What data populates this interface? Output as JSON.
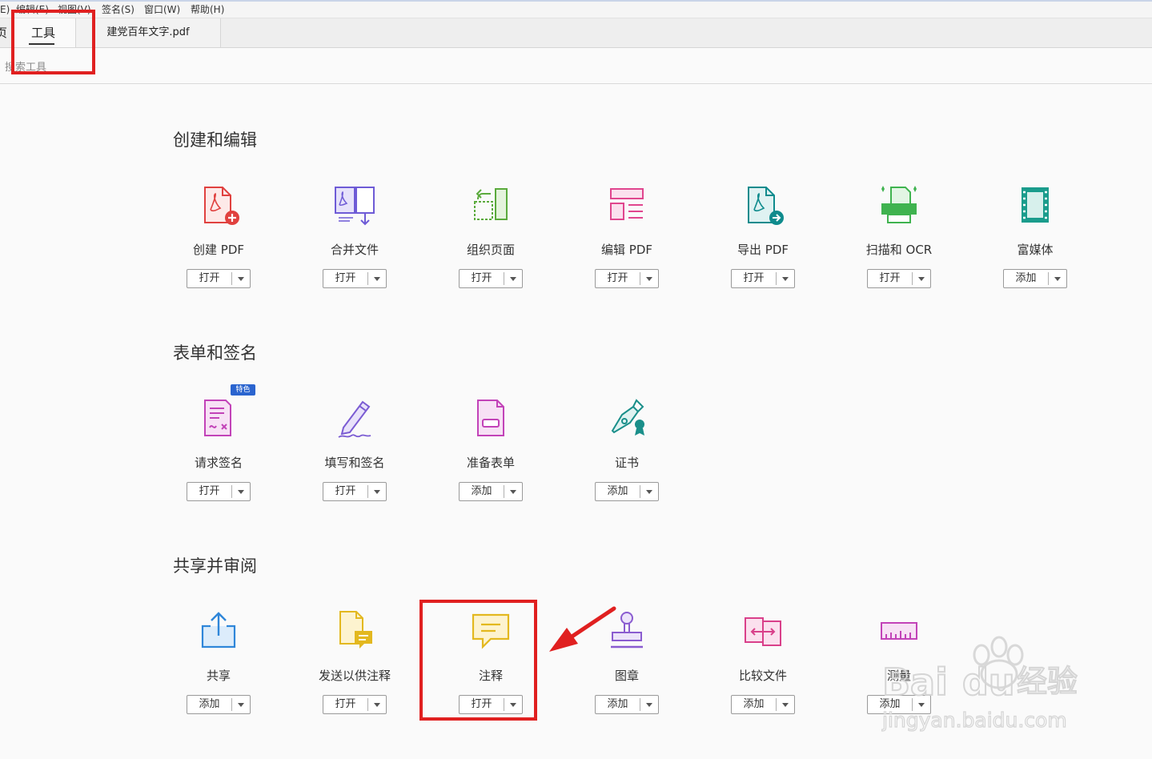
{
  "menubar": {
    "items": [
      {
        "label": "E)"
      },
      {
        "label": "编辑(E)"
      },
      {
        "label": "视图(V)"
      },
      {
        "label": "签名(S)"
      },
      {
        "label": "窗口(W)"
      },
      {
        "label": "帮助(H)"
      }
    ]
  },
  "tabs": {
    "home": "页",
    "tools": "工具",
    "document": "建党百年文字.pdf"
  },
  "search": {
    "label": "搜索工具"
  },
  "sections": [
    {
      "title": "创建和编辑",
      "tools": [
        {
          "label": "创建 PDF",
          "button": "打开",
          "icon": "create-pdf-icon",
          "color": "#e0413f"
        },
        {
          "label": "合并文件",
          "button": "打开",
          "icon": "combine-files-icon",
          "color": "#6e5bd6"
        },
        {
          "label": "组织页面",
          "button": "打开",
          "icon": "organize-pages-icon",
          "color": "#5aaa3c"
        },
        {
          "label": "编辑 PDF",
          "button": "打开",
          "icon": "edit-pdf-icon",
          "color": "#e0468e"
        },
        {
          "label": "导出 PDF",
          "button": "打开",
          "icon": "export-pdf-icon",
          "color": "#0f8b8d"
        },
        {
          "label": "扫描和 OCR",
          "button": "打开",
          "icon": "scan-ocr-icon",
          "color": "#3fb34f"
        },
        {
          "label": "富媒体",
          "button": "添加",
          "icon": "rich-media-icon",
          "color": "#1a9c8c"
        }
      ]
    },
    {
      "title": "表单和签名",
      "tools": [
        {
          "label": "请求签名",
          "button": "打开",
          "icon": "request-signature-icon",
          "color": "#c243b8",
          "badge": "特色"
        },
        {
          "label": "填写和签名",
          "button": "打开",
          "icon": "fill-sign-icon",
          "color": "#7b5cd3"
        },
        {
          "label": "准备表单",
          "button": "添加",
          "icon": "prepare-form-icon",
          "color": "#c243b8"
        },
        {
          "label": "证书",
          "button": "添加",
          "icon": "certificate-icon",
          "color": "#1a8f8a"
        }
      ]
    },
    {
      "title": "共享并审阅",
      "tools": [
        {
          "label": "共享",
          "button": "添加",
          "icon": "share-icon",
          "color": "#2f86d9"
        },
        {
          "label": "发送以供注释",
          "button": "打开",
          "icon": "send-comment-icon",
          "color": "#e3b81f"
        },
        {
          "label": "注释",
          "button": "打开",
          "icon": "comment-icon",
          "color": "#e3b81f"
        },
        {
          "label": "图章",
          "button": "添加",
          "icon": "stamp-icon",
          "color": "#8a5cd0"
        },
        {
          "label": "比较文件",
          "button": "添加",
          "icon": "compare-files-icon",
          "color": "#d9408a"
        },
        {
          "label": "测量",
          "button": "添加",
          "icon": "measure-icon",
          "color": "#c243b8"
        }
      ]
    }
  ],
  "highlight_color": "#e02020",
  "watermark": {
    "brand": "Bai",
    "brand2": "du",
    "cn": "经验",
    "url": "jingyan.baidu.com"
  }
}
